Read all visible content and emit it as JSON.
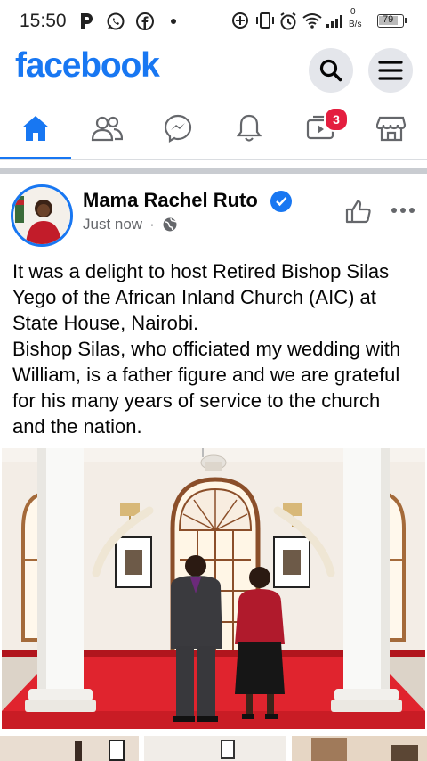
{
  "status_bar": {
    "time": "15:50",
    "data_speed_value": "0",
    "data_speed_unit": "B/s",
    "battery": "79"
  },
  "header": {
    "logo": "facebook",
    "icons": [
      "search-icon",
      "menu-icon"
    ]
  },
  "tabs": {
    "items": [
      "home-icon",
      "friends-icon",
      "messenger-icon",
      "notifications-icon",
      "video-icon",
      "marketplace-icon"
    ],
    "video_badge": "3",
    "active": "home"
  },
  "post": {
    "author": "Mama Rachel Ruto",
    "timestamp": "Just now",
    "separator": "·",
    "paragraph1": "It was a delight to host Retired Bishop Silas Yego of the African Inland Church (AIC) at State House, Nairobi.",
    "paragraph2": "Bishop Silas, who officiated my wedding with William, is a father figure and we are grateful for his many years of service to the church and the nation."
  },
  "colors": {
    "brand": "#1877f2",
    "badge": "#e41e3f",
    "meta": "#65676b",
    "carpet": "#e0242e"
  }
}
